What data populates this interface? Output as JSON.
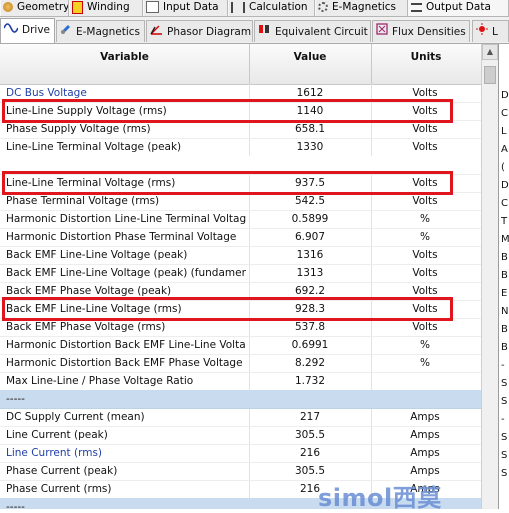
{
  "top_tabs": [
    "Geometry",
    "Winding",
    "Input Data",
    "Calculation",
    "E-Magnetics",
    "Output Data"
  ],
  "sub_tabs": [
    "Drive",
    "E-Magnetics",
    "Phasor Diagram",
    "Equivalent Circuit",
    "Flux Densities",
    "L"
  ],
  "table": {
    "headers": {
      "variable": "Variable",
      "value": "Value",
      "units": "Units"
    },
    "rows": [
      {
        "variable": "DC Bus Voltage",
        "value": "1612",
        "units": "Volts",
        "link": true
      },
      {
        "variable": "Line-Line Supply Voltage (rms)",
        "value": "1140",
        "units": "Volts",
        "highlight": true
      },
      {
        "variable": "Phase Supply Voltage (rms)",
        "value": "658.1",
        "units": "Volts"
      },
      {
        "variable": "Line-Line Terminal Voltage (peak)",
        "value": "1330",
        "units": "Volts"
      },
      {
        "variable": "",
        "value": "",
        "units": "",
        "gap": true
      },
      {
        "variable": "Line-Line Terminal Voltage (rms)",
        "value": "937.5",
        "units": "Volts",
        "highlight": true
      },
      {
        "variable": "Phase Terminal Voltage (rms)",
        "value": "542.5",
        "units": "Volts"
      },
      {
        "variable": "Harmonic Distortion Line-Line Terminal Voltage",
        "value": "0.5899",
        "units": "%"
      },
      {
        "variable": "Harmonic Distortion Phase Terminal Voltage",
        "value": "6.907",
        "units": "%"
      },
      {
        "variable": "Back EMF Line-Line Voltage (peak)",
        "value": "1316",
        "units": "Volts"
      },
      {
        "variable": "Back EMF Line-Line Voltage (peak) (fundamental)",
        "value": "1313",
        "units": "Volts"
      },
      {
        "variable": "Back EMF Phase Voltage (peak)",
        "value": "692.2",
        "units": "Volts"
      },
      {
        "variable": "Back EMF Line-Line Voltage (rms)",
        "value": "928.3",
        "units": "Volts",
        "highlight": true
      },
      {
        "variable": "Back EMF Phase Voltage (rms)",
        "value": "537.8",
        "units": "Volts"
      },
      {
        "variable": "Harmonic Distortion Back EMF Line-Line Voltage",
        "value": "0.6991",
        "units": "%"
      },
      {
        "variable": "Harmonic Distortion Back EMF Phase Voltage",
        "value": "8.292",
        "units": "%"
      },
      {
        "variable": "Max Line-Line / Phase Voltage Ratio",
        "value": "1.732",
        "units": ""
      },
      {
        "variable": "-----",
        "value": "",
        "units": "",
        "separator": true
      },
      {
        "variable": "DC Supply Current (mean)",
        "value": "217",
        "units": "Amps"
      },
      {
        "variable": "Line Current (peak)",
        "value": "305.5",
        "units": "Amps"
      },
      {
        "variable": "Line Current (rms)",
        "value": "216",
        "units": "Amps",
        "link": true
      },
      {
        "variable": "Phase Current (peak)",
        "value": "305.5",
        "units": "Amps"
      },
      {
        "variable": "Phase Current (rms)",
        "value": "216",
        "units": "Amps"
      },
      {
        "variable": "-----",
        "value": "",
        "units": "",
        "separator": true
      }
    ]
  },
  "right_panel_letters": [
    "D",
    "C",
    "L",
    "A",
    "(",
    "D",
    "C",
    "T",
    "M",
    "B",
    "B",
    "E",
    "N",
    "B",
    "B",
    "-",
    "S",
    "S",
    "-",
    "S",
    "S",
    "S"
  ],
  "watermark": "simol西莫",
  "colors": {
    "highlight": "#e0161e",
    "separator": "#c9dcef",
    "link": "#1f3fa6"
  },
  "icons": {
    "drive": "sine-wave-icon",
    "emag": "magnet-icon",
    "phasor": "phasor-icon",
    "eqcircuit": "circuit-icon",
    "flux": "flux-icon"
  }
}
